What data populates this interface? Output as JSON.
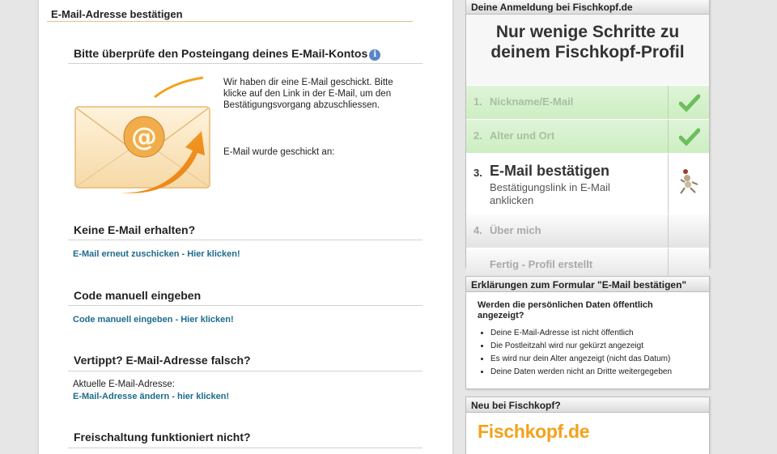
{
  "main": {
    "title": "E-Mail-Adresse bestätigen",
    "inbox_heading": "Bitte überprüfe den Posteingang deines E-Mail-Kontos",
    "info_icon": "i",
    "info_text": "Wir haben dir eine E-Mail geschickt. Bitte klicke auf den Link in der E-Mail, um den Bestätigungsvorgang abzuschliessen.",
    "sent_label": "E-Mail wurde geschickt an:",
    "envelope_symbol": "@",
    "no_mail_heading": "Keine E-Mail erhalten?",
    "resend_link": "E-Mail erneut zuschicken - Hier klicken!",
    "manual_heading": "Code manuell eingeben",
    "manual_link": "Code manuell eingeben - Hier klicken!",
    "wrong_heading": "Vertippt? E-Mail-Adresse falsch?",
    "current_label": "Aktuelle E-Mail-Adresse:",
    "change_link": "E-Mail-Adresse ändern - hier klicken!",
    "activation_heading": "Freischaltung funktioniert nicht?"
  },
  "steps": {
    "header": "Deine Anmeldung bei Fischkopf.de",
    "title_line1": "Nur wenige Schritte zu",
    "title_line2": "deinem Fischkopf-Profil",
    "items": [
      {
        "num": "1.",
        "label": "Nickname/E-Mail",
        "state": "done"
      },
      {
        "num": "2.",
        "label": "Alter und Ort",
        "state": "done"
      },
      {
        "num": "3.",
        "label": "E-Mail bestätigen",
        "sub": "Bestätigungslink in E-Mail anklicken",
        "state": "active"
      },
      {
        "num": "4.",
        "label": "Über mich",
        "state": "future"
      },
      {
        "num": "",
        "label": "Fertig - Profil erstellt",
        "state": "future"
      }
    ]
  },
  "explanation": {
    "header": "Erklärungen zum Formular \"E-Mail bestätigen\"",
    "question": "Werden die persönlichen Daten öffentlich angezeigt?",
    "bullets": [
      "Deine E-Mail-Adresse ist nicht öffentlich",
      "Die Postleitzahl wird nur gekürzt angezeigt",
      "Es wird nur dein Alter angezeigt (nicht das Datum)",
      "Deine Daten werden nicht an Dritte weitergegeben"
    ]
  },
  "new": {
    "header": "Neu bei Fischkopf?",
    "logo": "Fischkopf.de"
  },
  "colors": {
    "accent_orange": "#f3a21b",
    "link_blue": "#1d6b8c",
    "done_green": "#6cbf5c"
  }
}
